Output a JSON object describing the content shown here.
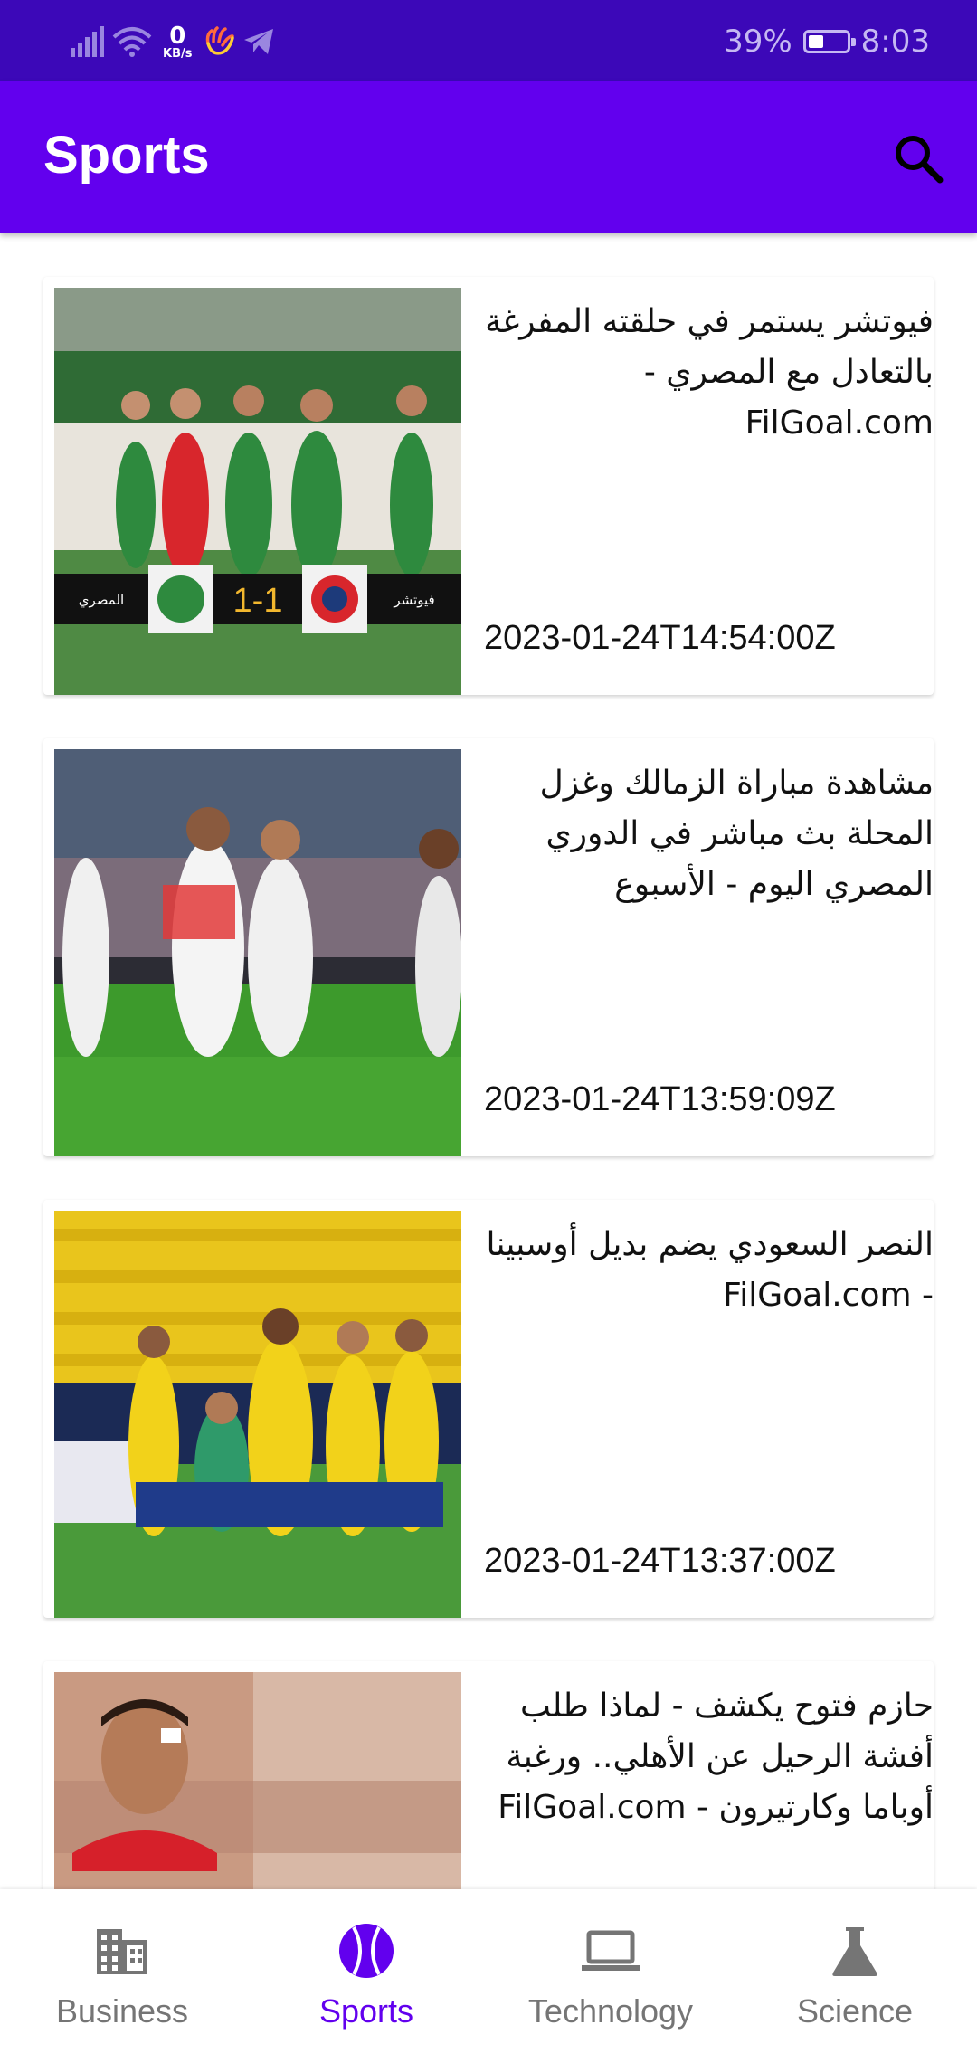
{
  "status_bar": {
    "net_speed_value": "0",
    "net_speed_unit": "KB/s",
    "battery_percent": "39%",
    "battery_level": 0.39,
    "time": "8:03",
    "icons": [
      "signal-icon",
      "wifi-icon",
      "hand-icon",
      "telegram-icon",
      "battery-icon"
    ]
  },
  "app_bar": {
    "title": "Sports",
    "search_icon": "search-icon"
  },
  "articles": [
    {
      "title": "فيوتشر يستمر في حلقته المفرغة بالتعادل مع المصري - FilGoal.com",
      "date": "2023-01-24T14:54:00Z",
      "scoreboard": {
        "left": "المصري",
        "score": "1-1",
        "right": "فيوتشر"
      }
    },
    {
      "title": "مشاهدة مباراة الزمالك وغزل المحلة بث مباشر في الدوري المصري اليوم - الأسبوع",
      "date": "2023-01-24T13:59:09Z"
    },
    {
      "title": "النصر السعودي يضم بديل أوسبينا - FilGoal.com",
      "date": "2023-01-24T13:37:00Z"
    },
    {
      "title": "حازم فتوح يكشف - لماذا طلب أفشة الرحيل عن الأهلي.. ورغبة أوباما وكارتيرون - FilGoal.com",
      "date": ""
    }
  ],
  "bottom_nav": {
    "items": [
      {
        "label": "Business",
        "icon": "building-icon",
        "active": false
      },
      {
        "label": "Sports",
        "icon": "sports-ball-icon",
        "active": true
      },
      {
        "label": "Technology",
        "icon": "laptop-icon",
        "active": false
      },
      {
        "label": "Science",
        "icon": "flask-icon",
        "active": false
      }
    ]
  },
  "colors": {
    "status_bar": "#3c08b8",
    "app_bar": "#6200ee",
    "nav_active": "#6200ee",
    "nav_inactive": "#757575"
  }
}
